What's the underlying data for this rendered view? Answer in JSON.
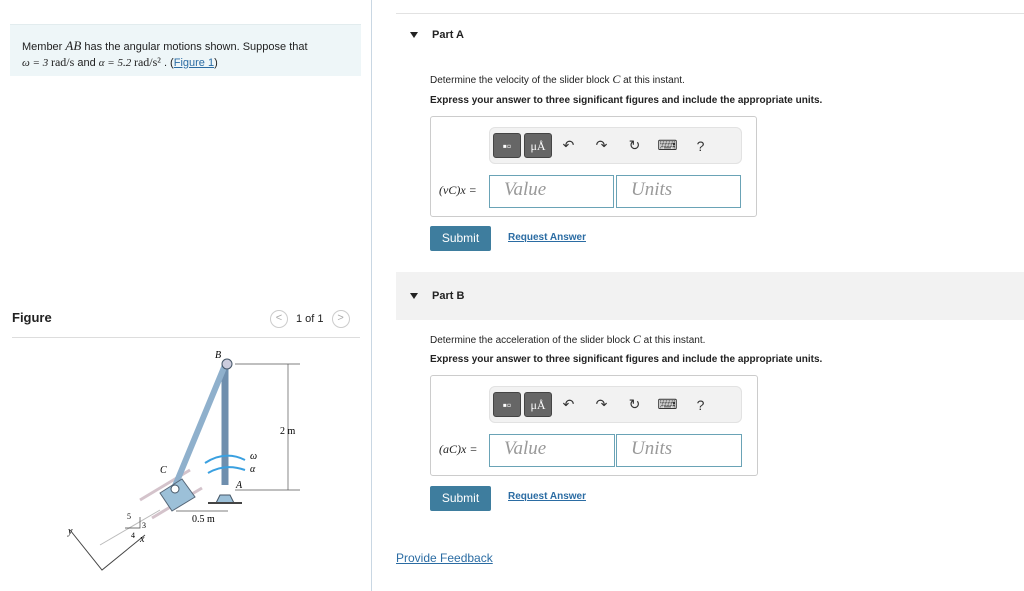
{
  "problem": {
    "text_pre": "Member ",
    "member": "AB",
    "text_mid": " has the angular motions shown. Suppose that",
    "omega": "ω = 3 ",
    "omega_unit": "rad/s",
    "and": " and ",
    "alpha": "α = 5.2 ",
    "alpha_unit": "rad/s²",
    "dot": " . (",
    "figure_link": "Figure 1",
    "close": ")"
  },
  "figure": {
    "label": "Figure",
    "pager": "1 of 1",
    "prev": "<",
    "next": ">",
    "labels": {
      "B": "B",
      "C": "C",
      "A": "A",
      "omega": "ω",
      "alpha": "α",
      "height": "2 m",
      "width": "0.5 m",
      "five": "5",
      "three": "3",
      "four": "4",
      "x": "x",
      "y": "y"
    }
  },
  "parts": [
    {
      "title": "Part A",
      "q1_pre": "Determine the velocity of the slider block ",
      "q1_var": "C",
      "q1_post": " at this instant.",
      "q2": "Express your answer to three significant figures and include the appropriate units.",
      "label": "(vC)x =",
      "value_ph": "Value",
      "units_ph": "Units",
      "submit": "Submit",
      "request": "Request Answer"
    },
    {
      "title": "Part B",
      "q1_pre": "Determine the acceleration of the slider block ",
      "q1_var": "C",
      "q1_post": " at this instant.",
      "q2": "Express your answer to three significant figures and include the appropriate units.",
      "label": "(aC)x =",
      "value_ph": "Value",
      "units_ph": "Units",
      "submit": "Submit",
      "request": "Request Answer"
    }
  ],
  "toolbar": {
    "templates": "▪▫",
    "units": "μÅ",
    "undo": "↶",
    "redo": "↷",
    "reset": "↻",
    "keyboard": "⌨",
    "help": "?"
  },
  "feedback": "Provide Feedback"
}
